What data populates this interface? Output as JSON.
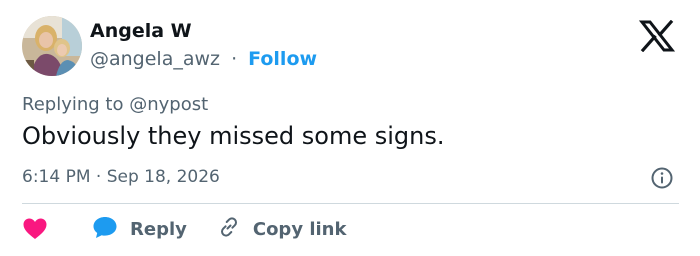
{
  "author": {
    "name": "Angela W",
    "handle": "@angela_awz",
    "separator": "·",
    "follow_label": "Follow"
  },
  "brand": {
    "logo_icon": "x-logo-icon"
  },
  "reply_context": {
    "prefix": "Replying to ",
    "mention": "@nypost"
  },
  "tweet": {
    "text": "Obviously they missed some signs.",
    "timestamp": "6:14 PM · Sep 18, 2026"
  },
  "actions": {
    "like_icon": "heart-icon",
    "reply_label": "Reply",
    "copy_link_label": "Copy link"
  },
  "colors": {
    "accent": "#1d9bf0",
    "like": "#f91880",
    "muted": "#536471",
    "text": "#0f1419",
    "divider": "#cfd9de"
  }
}
